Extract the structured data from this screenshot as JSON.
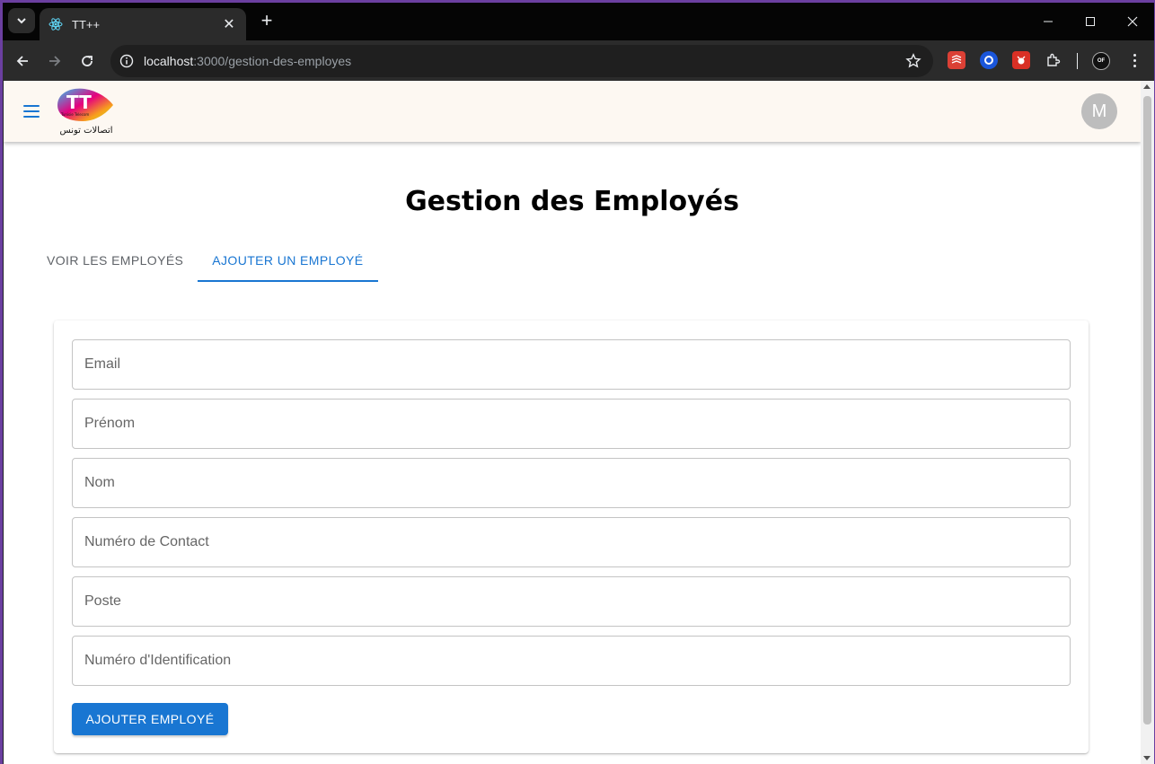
{
  "browser": {
    "tab_title": "TT++",
    "url_host": "localhost",
    "url_path": ":3000/gestion-des-employes"
  },
  "app": {
    "logo_text": "TT",
    "logo_sub_arabic": "اتصالات تونس",
    "logo_small_text": "Tunisie Telecom",
    "avatar_initial": "M"
  },
  "page": {
    "title": "Gestion des Employés",
    "tabs": [
      {
        "label": "VOIR LES EMPLOYÉS",
        "active": false
      },
      {
        "label": "AJOUTER UN EMPLOYÉ",
        "active": true
      }
    ]
  },
  "form": {
    "fields": [
      {
        "placeholder": "Email",
        "value": ""
      },
      {
        "placeholder": "Prénom",
        "value": ""
      },
      {
        "placeholder": "Nom",
        "value": ""
      },
      {
        "placeholder": "Numéro de Contact",
        "value": ""
      },
      {
        "placeholder": "Poste",
        "value": ""
      },
      {
        "placeholder": "Numéro d'Identification",
        "value": ""
      }
    ],
    "submit_label": "AJOUTER EMPLOYÉ"
  },
  "colors": {
    "primary": "#1976d2",
    "appbar_bg": "#fdf8f2",
    "avatar_bg": "#bdbdbd"
  }
}
